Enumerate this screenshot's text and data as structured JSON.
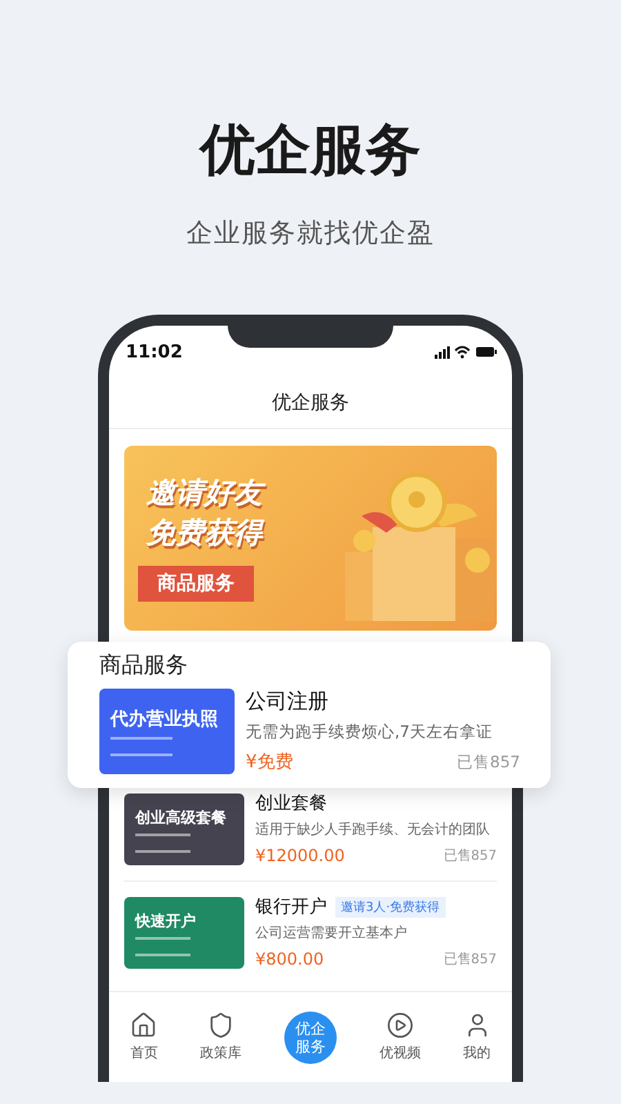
{
  "hero": {
    "title": "优企服务",
    "subtitle": "企业服务就找优企盈"
  },
  "status_bar": {
    "time": "11:02"
  },
  "header": {
    "title": "优企服务"
  },
  "banner": {
    "line_1": "邀请好友",
    "line_2": "免费获得",
    "ribbon": "商品服务"
  },
  "section": {
    "title": "商品服务"
  },
  "products": [
    {
      "name": "公司注册",
      "description": "无需为跑手续费烦心,7天左右拿证",
      "price": "¥免费",
      "sold": "已售857",
      "thumb_title": "代办营业执照",
      "color": "#3d63f0"
    },
    {
      "name": "创业套餐",
      "description": "适用于缺少人手跑手续、无会计的团队",
      "price": "¥12000.00",
      "sold": "已售857",
      "thumb_title": "创业高级套餐",
      "color": "#44434f"
    },
    {
      "name": "银行开户",
      "badge": "邀请3人·免费获得",
      "description": "公司运营需要开立基本户",
      "price": "¥800.00",
      "sold": "已售857",
      "thumb_title": "快速开户",
      "color": "#1f8a64"
    }
  ],
  "nav": [
    {
      "label": "首页",
      "selected": false
    },
    {
      "label": "政策库",
      "selected": false
    },
    {
      "label": "优企服务",
      "selected": true
    },
    {
      "label": "优视频",
      "selected": false
    },
    {
      "label": "我的",
      "selected": false
    }
  ]
}
